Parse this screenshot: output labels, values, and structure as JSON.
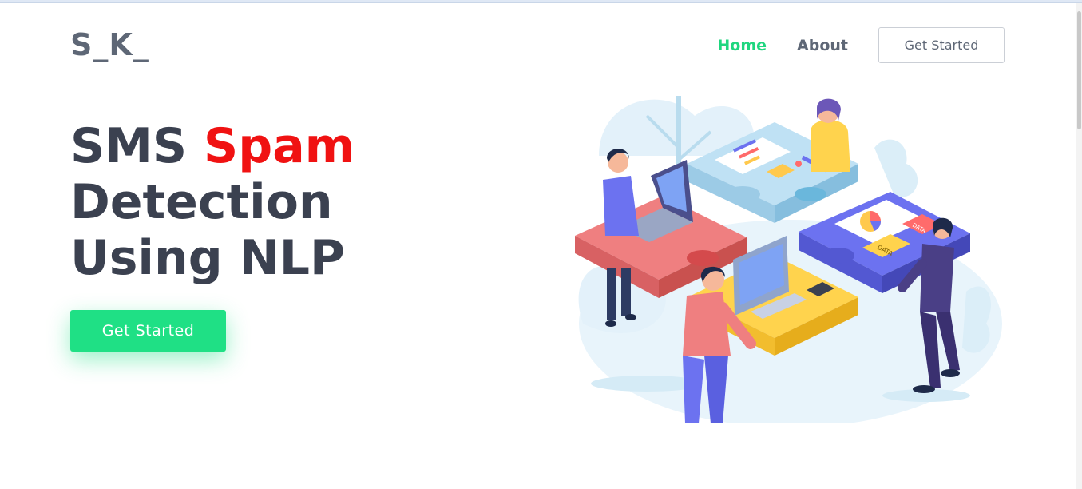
{
  "brand": {
    "logo": "S_K_"
  },
  "nav": {
    "items": [
      {
        "label": "Home",
        "active": true
      },
      {
        "label": "About",
        "active": false
      }
    ],
    "cta_label": "Get Started"
  },
  "hero": {
    "title_part1": "SMS ",
    "title_accent": "Spam",
    "title_part2": "Detection Using NLP",
    "cta_label": "Get Started"
  },
  "illustration": {
    "icon": "teamwork-puzzle-illustration",
    "tags": [
      "DATA",
      "DATA"
    ]
  },
  "colors": {
    "accent_green": "#1fe085",
    "nav_active": "#1fd67f",
    "title_accent": "#f01212",
    "text_dark": "#3b4150",
    "text_muted": "#5e6776"
  }
}
